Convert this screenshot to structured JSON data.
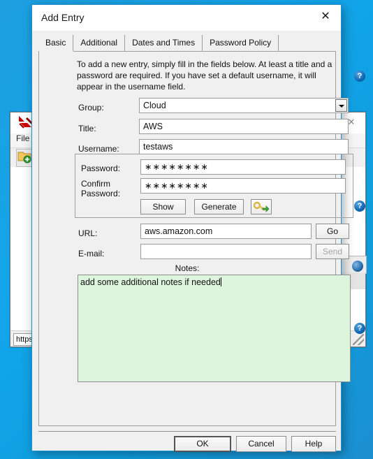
{
  "background_window": {
    "name": "keepass-main-window",
    "menu": {
      "file_label": "File"
    },
    "close_label": "✕",
    "toolbar_icons": [
      "new-group-icon",
      "group-users-icon"
    ],
    "status_text": "https"
  },
  "dialog": {
    "title": "Add Entry",
    "close_label": "✕",
    "tabs": [
      {
        "label": "Basic",
        "active": true
      },
      {
        "label": "Additional",
        "active": false
      },
      {
        "label": "Dates and Times",
        "active": false
      },
      {
        "label": "Password Policy",
        "active": false
      }
    ],
    "intro_text": "To add a new entry, simply fill in the fields below. At least a title and a password are required. If you have set a default username, it will appear in the username field.",
    "fields": {
      "group": {
        "label": "Group:",
        "value": "Cloud"
      },
      "title": {
        "label": "Title:",
        "value": "AWS"
      },
      "username": {
        "label": "Username:",
        "value": "testaws"
      },
      "password": {
        "label": "Password:",
        "value": "∗∗∗∗∗∗∗∗"
      },
      "confirm_password": {
        "label_line1": "Confirm",
        "label_line2": "Password:",
        "value": "∗∗∗∗∗∗∗∗"
      },
      "url": {
        "label": "URL:",
        "value": "aws.amazon.com"
      },
      "email": {
        "label": "E-mail:",
        "value": "",
        "placeholder": ""
      },
      "notes": {
        "label": "Notes:",
        "value": "add some additional notes if needed"
      }
    },
    "buttons": {
      "show": "Show",
      "generate": "Generate",
      "key_tool": "key-generate-icon",
      "go": "Go",
      "send": "Send",
      "send_disabled": true,
      "ok": "OK",
      "cancel": "Cancel",
      "help": "Help"
    },
    "help_icons": {
      "glyph": "?",
      "count": 3
    }
  },
  "colors": {
    "desktop_blue": "#12a5ea",
    "dialog_face": "#f0f0f0",
    "notes_background": "#dcf5dc",
    "help_blue": "#0c62b0",
    "accent_border": "#1a8fd4"
  }
}
